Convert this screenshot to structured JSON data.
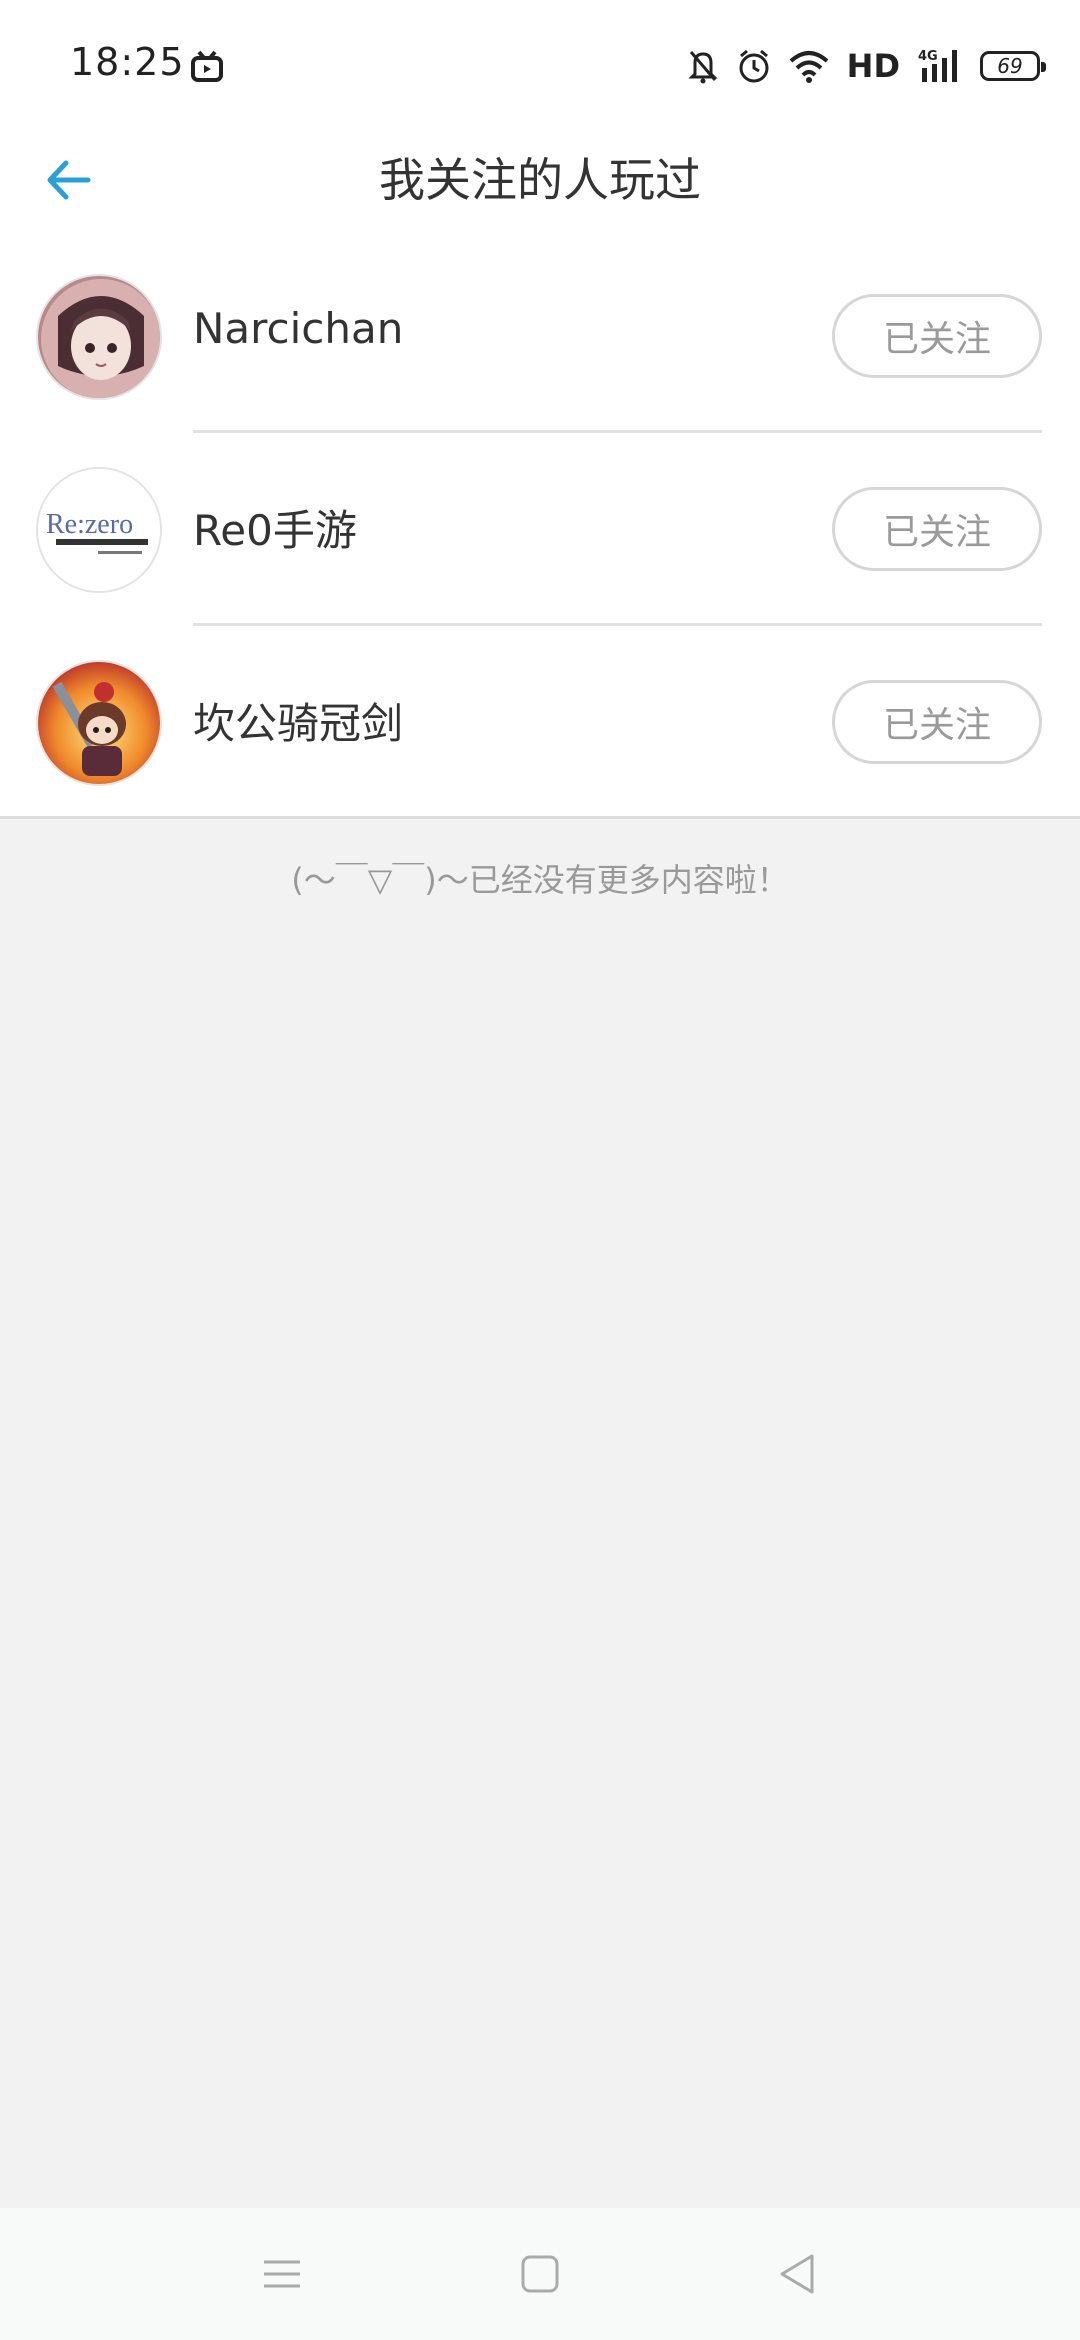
{
  "status_bar": {
    "time": "18:25",
    "hd": "HD",
    "network": "4G",
    "battery": "69"
  },
  "header": {
    "title": "我关注的人玩过",
    "back_icon": "arrow-left-icon"
  },
  "users": [
    {
      "name": "Narcichan",
      "follow_label": "已关注"
    },
    {
      "name": "Re0手游",
      "follow_label": "已关注",
      "avatar_text": "Re:zero"
    },
    {
      "name": "坎公骑冠剑",
      "follow_label": "已关注"
    }
  ],
  "end_note": "(～￣▽￣)～已经没有更多内容啦！",
  "colors": {
    "accent": "#2a9fd6",
    "background": "#f2f2f3",
    "button_border": "#d6d6d6",
    "button_text": "#9a9a9a"
  }
}
